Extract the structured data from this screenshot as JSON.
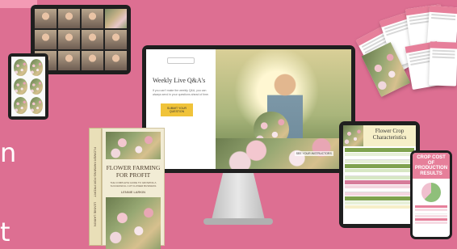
{
  "colors": {
    "background": "#dd6f92",
    "accent": "#e56b8d",
    "button": "#f0c33a"
  },
  "cut_text": {
    "line1": "n",
    "line2": "t"
  },
  "monitor": {
    "title": "Weekly Live Q&A's",
    "body": "If you can't make the weekly Q&A, you can always send in your questions ahead of time.",
    "button": "SUBMIT YOUR QUESTION",
    "caption": "SEE YOUR INSTRUCTORS"
  },
  "book": {
    "spine": "FLOWER FARMING FOR PROFIT",
    "author_spine": "LENNIE LARKIN",
    "title_line1": "FLOWER FARMING",
    "title_line2": "FOR PROFIT",
    "subtitle": "THE COMPLETE GUIDE TO GROWING A SUCCESSFUL CUT FLOWER BUSINESS",
    "author": "LENNIE LARKIN"
  },
  "tablet": {
    "title_line1": "Flower Crop",
    "title_line2": "Characteristics"
  },
  "phone": {
    "title_line1": "CROP COST",
    "title_line2": "OF",
    "title_line3": "PRODUCTION",
    "title_line4": "RESULTS"
  }
}
